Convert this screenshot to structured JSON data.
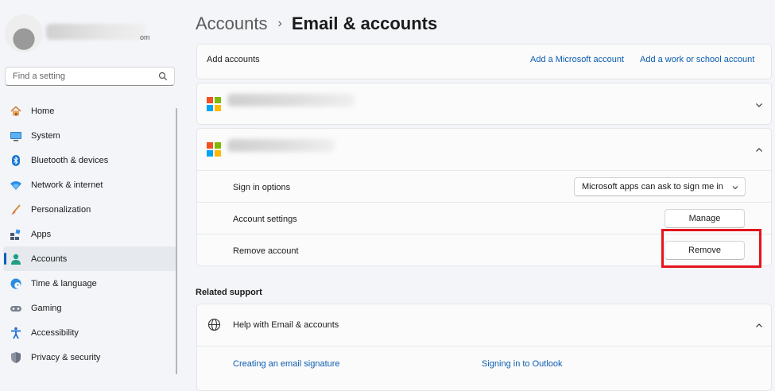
{
  "user": {
    "email_suffix": "om"
  },
  "search": {
    "placeholder": "Find a setting",
    "icon": "search-icon"
  },
  "nav": {
    "items": [
      {
        "label": "Home",
        "icon": "home-icon"
      },
      {
        "label": "System",
        "icon": "system-icon"
      },
      {
        "label": "Bluetooth & devices",
        "icon": "bluetooth-icon"
      },
      {
        "label": "Network & internet",
        "icon": "wifi-icon"
      },
      {
        "label": "Personalization",
        "icon": "brush-icon"
      },
      {
        "label": "Apps",
        "icon": "apps-icon"
      },
      {
        "label": "Accounts",
        "icon": "person-icon",
        "selected": true
      },
      {
        "label": "Time & language",
        "icon": "globe-clock-icon"
      },
      {
        "label": "Gaming",
        "icon": "gamepad-icon"
      },
      {
        "label": "Accessibility",
        "icon": "accessibility-icon"
      },
      {
        "label": "Privacy & security",
        "icon": "shield-icon"
      }
    ]
  },
  "breadcrumb": {
    "parent": "Accounts",
    "separator": "›",
    "current": "Email & accounts"
  },
  "add_accounts": {
    "label": "Add accounts",
    "microsoft_link": "Add a Microsoft account",
    "work_link": "Add a work or school account"
  },
  "account_options": {
    "sign_in_label": "Sign in options",
    "sign_in_value": "Microsoft apps can ask to sign me in",
    "settings_label": "Account settings",
    "manage_button": "Manage",
    "remove_label": "Remove account",
    "remove_button": "Remove"
  },
  "related": {
    "title": "Related support",
    "help_label": "Help with Email & accounts",
    "link_signature": "Creating an email signature",
    "link_outlook": "Signing in to Outlook"
  },
  "colors": {
    "accent": "#005fb8",
    "link": "#0b5cad",
    "highlight": "#e3141b",
    "ms_red": "#f25022",
    "ms_green": "#7fba00",
    "ms_blue": "#00a4ef",
    "ms_yellow": "#ffb900"
  }
}
